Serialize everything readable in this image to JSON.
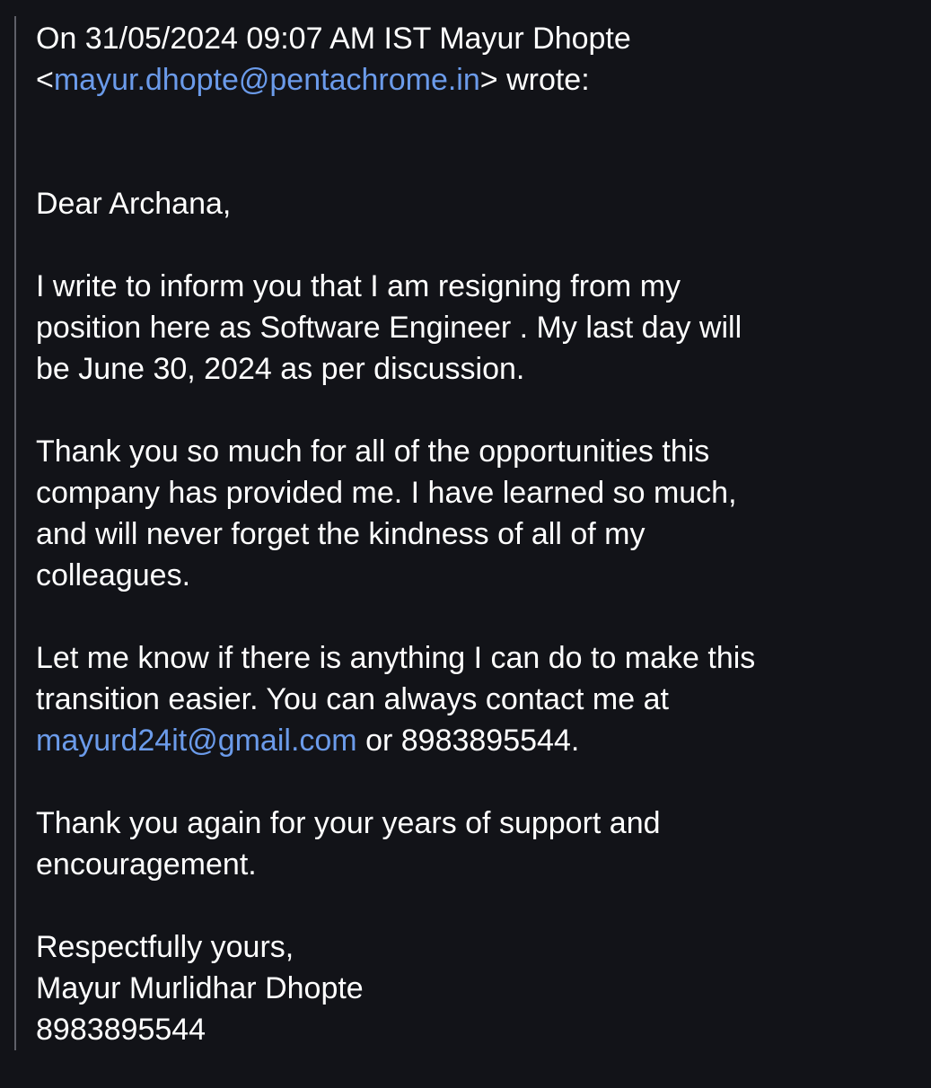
{
  "quote_header": {
    "line1": "On 31/05/2024 09:07 AM IST Mayur Dhopte",
    "open_angle": "<",
    "sender_email": "mayur.dhopte@pentachrome.in",
    "close_wrote": "> wrote:"
  },
  "greeting": "Dear Archana,",
  "para1": [
    "I write to inform you that I am resigning from my",
    "position here as Software Engineer . My last day will",
    "be June 30, 2024 as per discussion."
  ],
  "para2": [
    "Thank you so much for all of the opportunities this",
    "company has provided me. I have learned so much,",
    "and will never forget the kindness of all of my",
    "colleagues."
  ],
  "para3": {
    "line1": "Let me know if there is anything I can do to make this",
    "line2": "transition easier. You can always contact me at",
    "contact_email": "mayurd24it@gmail.com",
    "contact_suffix": " or 8983895544."
  },
  "para4": [
    "Thank you again for your years of support and",
    "encouragement."
  ],
  "signature": {
    "closing": "Respectfully yours,",
    "name": "Mayur Murlidhar Dhopte",
    "phone": "8983895544"
  },
  "colors": {
    "background": "#121318",
    "text": "#ffffff",
    "link": "#6b9bea",
    "quote_bar": "#5f6068"
  }
}
